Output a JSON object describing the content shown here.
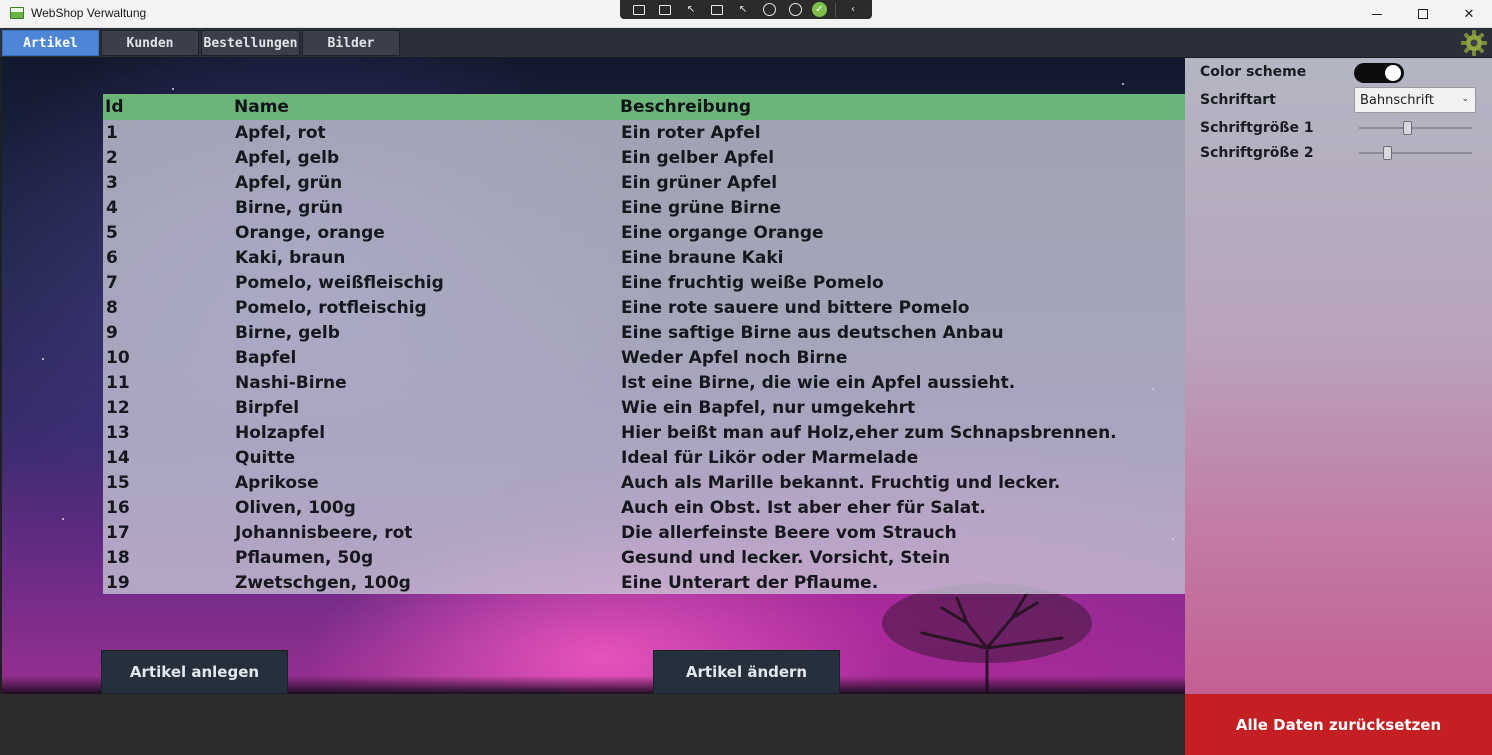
{
  "window": {
    "title": "WebShop Verwaltung"
  },
  "tabs": [
    {
      "label": "Artikel",
      "active": true
    },
    {
      "label": "Kunden",
      "active": false
    },
    {
      "label": "Bestellungen",
      "active": false
    },
    {
      "label": "Bilder",
      "active": false
    }
  ],
  "table": {
    "headers": {
      "id": "Id",
      "name": "Name",
      "description": "Beschreibung"
    },
    "rows": [
      {
        "id": "1",
        "name": "Apfel, rot",
        "description": "Ein roter Apfel"
      },
      {
        "id": "2",
        "name": "Apfel, gelb",
        "description": "Ein gelber Apfel"
      },
      {
        "id": "3",
        "name": "Apfel, grün",
        "description": "Ein grüner Apfel"
      },
      {
        "id": "4",
        "name": "Birne, grün",
        "description": "Eine grüne Birne"
      },
      {
        "id": "5",
        "name": "Orange, orange",
        "description": "Eine organge Orange"
      },
      {
        "id": "6",
        "name": "Kaki, braun",
        "description": "Eine braune Kaki"
      },
      {
        "id": "7",
        "name": "Pomelo, weißfleischig",
        "description": "Eine fruchtig weiße Pomelo"
      },
      {
        "id": "8",
        "name": "Pomelo, rotfleischig",
        "description": "Eine rote sauere und bittere Pomelo"
      },
      {
        "id": "9",
        "name": "Birne, gelb",
        "description": "Eine saftige Birne aus deutschen Anbau"
      },
      {
        "id": "10",
        "name": "Bapfel",
        "description": "Weder Apfel noch Birne"
      },
      {
        "id": "11",
        "name": "Nashi-Birne",
        "description": "Ist eine Birne, die wie ein Apfel aussieht."
      },
      {
        "id": "12",
        "name": "Birpfel",
        "description": "Wie ein Bapfel, nur umgekehrt"
      },
      {
        "id": "13",
        "name": "Holzapfel",
        "description": "Hier beißt man auf Holz,eher zum Schnapsbrennen."
      },
      {
        "id": "14",
        "name": "Quitte",
        "description": "Ideal für Likör oder Marmelade"
      },
      {
        "id": "15",
        "name": "Aprikose",
        "description": "Auch als Marille bekannt. Fruchtig und lecker."
      },
      {
        "id": "16",
        "name": "Oliven, 100g",
        "description": "Auch ein Obst. Ist aber eher für Salat."
      },
      {
        "id": "17",
        "name": "Johannisbeere, rot",
        "description": "Die allerfeinste Beere vom Strauch"
      },
      {
        "id": "18",
        "name": "Pflaumen, 50g",
        "description": "Gesund und lecker. Vorsicht, Stein"
      },
      {
        "id": "19",
        "name": "Zwetschgen, 100g",
        "description": "Eine Unterart der Pflaume."
      }
    ]
  },
  "actions": {
    "create_label": "Artikel anlegen",
    "edit_label": "Artikel ändern",
    "reset_label": "Alle Daten zurücksetzen"
  },
  "settings": {
    "color_scheme_label": "Color scheme",
    "color_scheme_on": true,
    "font_label": "Schriftart",
    "font_value": "Bahnschrift",
    "font_size1_label": "Schriftgröße 1",
    "font_size1_level": 0.42,
    "font_size2_label": "Schriftgröße 2",
    "font_size2_level": 0.23
  },
  "colors": {
    "active_tab": "#4d86d6",
    "table_header": "#6cb579",
    "reset_button": "#c41f22"
  },
  "icons": {
    "app": "app-window-icon",
    "settings": "gear-icon"
  }
}
